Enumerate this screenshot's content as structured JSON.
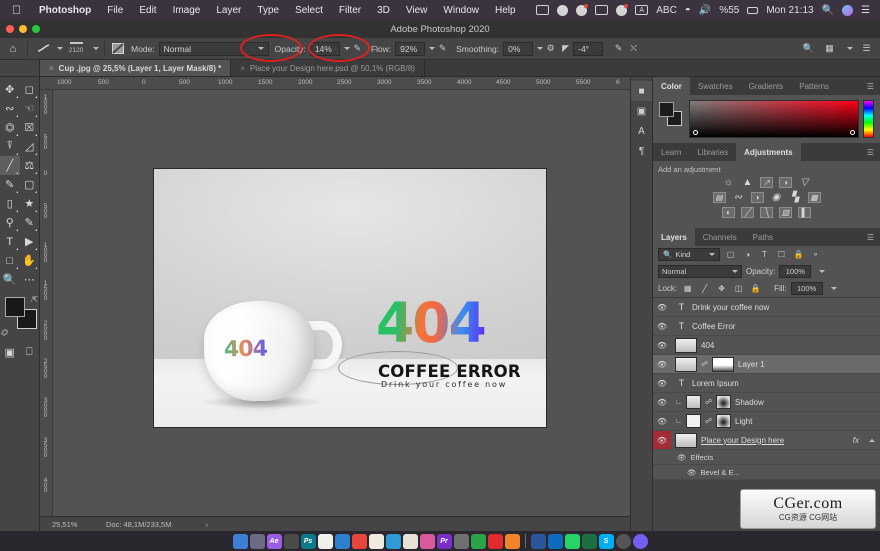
{
  "macbar": {
    "apple_icon": "apple-icon",
    "menus": [
      "Photoshop",
      "File",
      "Edit",
      "Image",
      "Layer",
      "Type",
      "Select",
      "Filter",
      "3D",
      "View",
      "Window",
      "Help"
    ],
    "status_icons": [
      "screen-record-icon",
      "checkmark-circle-icon",
      "phone-circle-icon",
      "display-icon",
      "globe-dot-icon",
      "keyboard-input-icon"
    ],
    "input_source": "ABC",
    "wifi_icon": "wifi-icon",
    "volume_icon": "volume-icon",
    "battery_text": "%55",
    "battery_icon": "battery-icon",
    "clock": "Mon 21:13",
    "search_icon": "search-icon",
    "siri_icon": "siri-icon",
    "control_center_icon": "control-center-icon"
  },
  "window": {
    "title": "Adobe Photoshop 2020",
    "traffic_lights": [
      "close-button",
      "minimize-button",
      "maximize-button"
    ]
  },
  "options_bar": {
    "home_icon": "home-icon",
    "brush_tool_icon": "brush-preset-icon",
    "brush_size": "2120",
    "brush_panel_icon": "brush-panel-icon",
    "mode_label": "Mode:",
    "mode_value": "Normal",
    "opacity_label": "Opacity:",
    "opacity_value": "14%",
    "pressure_opacity_icon": "pressure-opacity-icon",
    "flow_label": "Flow:",
    "flow_value": "92%",
    "airbrush_icon": "airbrush-icon",
    "smoothing_label": "Smoothing:",
    "smoothing_value": "0%",
    "smoothing_options_icon": "gear-icon",
    "angle_icon": "angle-icon",
    "angle_value": "-4°",
    "pressure_size_icon": "pressure-size-icon",
    "symmetry_icon": "symmetry-icon",
    "search_icon": "search-icon",
    "workspace_icon": "workspace-icon",
    "arrange_icon": "arrange-icon",
    "annotation_color": "#e02020"
  },
  "doc_tabs": [
    {
      "label": "Cup .jpg @ 25,5% (Layer 1, Layer Mask/8) *",
      "active": true,
      "close": "×"
    },
    {
      "label": "Place your Design here.psd @ 50,1% (RGB/8)",
      "active": false,
      "close": "×"
    }
  ],
  "toolbar": {
    "tools": [
      "move-tool",
      "marquee-tool",
      "lasso-tool",
      "quick-selection-tool",
      "crop-tool",
      "frame-tool",
      "eyedropper-tool",
      "healing-brush-tool",
      "brush-tool",
      "clone-stamp-tool",
      "history-brush-tool",
      "eraser-tool",
      "gradient-tool",
      "blur-tool",
      "dodge-tool",
      "pen-tool",
      "type-tool",
      "path-selection-tool",
      "rectangle-tool",
      "hand-tool",
      "zoom-tool",
      "more-tools"
    ],
    "selected_tool": "brush-tool",
    "foreground_color": "#181818",
    "background_color": "#1a1a1a",
    "swap_icon": "swap-colors-icon",
    "default_icon": "default-colors-icon",
    "quick_mask_icon": "quick-mask-icon",
    "screen_mode_icon": "screen-mode-icon"
  },
  "rulers": {
    "horizontal": [
      "1000",
      "500",
      "0",
      "500",
      "1000",
      "1500",
      "2000",
      "2500",
      "3000",
      "3500",
      "4000",
      "4500",
      "5000",
      "5500",
      "6"
    ],
    "vertical": [
      "1000",
      "500",
      "0",
      "500",
      "1000",
      "1500",
      "2000",
      "2500",
      "3000",
      "3500",
      "400"
    ]
  },
  "canvas": {
    "mug_logo_text": "404",
    "logo_number": "404",
    "logo_title": "COFFEE ERROR",
    "logo_subtitle": "Drink your coffee now"
  },
  "status_bar": {
    "zoom": "25,51%",
    "doc_info": "Doc: 48,1M/233,5M",
    "arrow": "›"
  },
  "right_rail": [
    "color-rail-icon",
    "history-rail-icon",
    "character-rail-icon",
    "paragraph-rail-icon"
  ],
  "color_panel": {
    "tabs": [
      {
        "label": "Color",
        "active": true
      },
      {
        "label": "Swatches",
        "active": false
      },
      {
        "label": "Gradients",
        "active": false
      },
      {
        "label": "Patterns",
        "active": false
      }
    ],
    "menu_icon": "panel-menu-icon",
    "foreground": "#1c1c1c",
    "background": "#1c1c1c",
    "ramp_hue": "#ff0018"
  },
  "adjustments_panel": {
    "tabs": [
      {
        "label": "Learn",
        "active": false
      },
      {
        "label": "Libraries",
        "active": false
      },
      {
        "label": "Adjustments",
        "active": true
      }
    ],
    "menu_icon": "panel-menu-icon",
    "heading": "Add an adjustment",
    "rows": [
      [
        "brightness-contrast-icon",
        "levels-icon",
        "curves-icon",
        "exposure-icon",
        "vibrance-icon"
      ],
      [
        "hue-saturation-icon",
        "color-balance-icon",
        "black-white-icon",
        "photo-filter-icon",
        "channel-mixer-icon",
        "color-lookup-icon"
      ],
      [
        "invert-icon",
        "posterize-icon",
        "threshold-icon",
        "gradient-map-icon",
        "selective-color-icon"
      ]
    ]
  },
  "layers_panel": {
    "tabs": [
      {
        "label": "Layers",
        "active": true
      },
      {
        "label": "Channels",
        "active": false
      },
      {
        "label": "Paths",
        "active": false
      }
    ],
    "menu_icon": "panel-menu-icon",
    "filter_icon": "search-icon",
    "filter_label": "Kind",
    "filter_toggles": [
      "pixel-filter-icon",
      "adjustment-filter-icon",
      "type-filter-icon",
      "shape-filter-icon",
      "smart-object-filter-icon"
    ],
    "filter_power_icon": "filter-power-icon",
    "blend_mode": "Normal",
    "opacity_label": "Opacity:",
    "opacity_value": "100%",
    "lock_label": "Lock:",
    "lock_icons": [
      "lock-transparent-icon",
      "lock-image-icon",
      "lock-position-icon",
      "lock-artboard-icon",
      "lock-all-icon"
    ],
    "fill_label": "Fill:",
    "fill_value": "100%",
    "layers": [
      {
        "name": "Drink your coffee now",
        "type": "text",
        "visible": true,
        "selected": false
      },
      {
        "name": "Coffee Error",
        "type": "text",
        "visible": true,
        "selected": false
      },
      {
        "name": "404",
        "type": "smart",
        "visible": true,
        "selected": false
      },
      {
        "name": "Layer 1",
        "type": "masked",
        "visible": true,
        "selected": true
      },
      {
        "name": "Lorem Ipsum",
        "type": "text",
        "visible": true,
        "selected": false
      },
      {
        "name": "Shadow",
        "type": "masked-clipped",
        "visible": true,
        "selected": false
      },
      {
        "name": "Light",
        "type": "masked-clipped",
        "visible": true,
        "selected": false
      },
      {
        "name": "Place your Design here",
        "type": "smart-fx",
        "visible": true,
        "selected": false,
        "highlight": "red",
        "fx": "fx"
      }
    ],
    "effects_label": "Effects",
    "effect_items": [
      "Bevel & E..."
    ],
    "effects_eye_icon": "eye-icon",
    "effect_eye_icon": "eye-icon"
  },
  "dock": {
    "apps": [
      {
        "name": "finder-dock-icon",
        "color": "#3d7fd6",
        "glyph": ""
      },
      {
        "name": "launchpad-dock-icon",
        "color": "#6b6b83",
        "glyph": ""
      },
      {
        "name": "after-effects-dock-icon",
        "color": "#9b5de5",
        "glyph": "Ae"
      },
      {
        "name": "safari-dock-icon",
        "color": "#4b4b4b",
        "glyph": ""
      },
      {
        "name": "photoshop-dock-icon",
        "color": "#0b7a8a",
        "glyph": "Ps"
      },
      {
        "name": "notes-dock-icon",
        "color": "#f2f0ea",
        "glyph": ""
      },
      {
        "name": "browser-dock-icon",
        "color": "#2f7fd0",
        "glyph": ""
      },
      {
        "name": "calendar-dock-icon",
        "color": "#e8453c",
        "glyph": ""
      },
      {
        "name": "books-dock-icon",
        "color": "#efe9e0",
        "glyph": ""
      },
      {
        "name": "edge-dock-icon",
        "color": "#2e9bd6",
        "glyph": ""
      },
      {
        "name": "notepad-dock-icon",
        "color": "#e6e2d8",
        "glyph": ""
      },
      {
        "name": "music-dock-icon",
        "color": "#d95a9a",
        "glyph": ""
      },
      {
        "name": "premiere-dock-icon",
        "color": "#7a2fc9",
        "glyph": "Pr"
      },
      {
        "name": "settings-dock-icon",
        "color": "#707070",
        "glyph": ""
      },
      {
        "name": "chrome-dock-icon",
        "color": "#2ca24a",
        "glyph": ""
      },
      {
        "name": "opera-dock-icon",
        "color": "#e22b2b",
        "glyph": ""
      },
      {
        "name": "mail-dock-icon",
        "color": "#f0862c",
        "glyph": ""
      }
    ],
    "apps2": [
      {
        "name": "word-dock-icon",
        "color": "#2b579a",
        "glyph": ""
      },
      {
        "name": "outlook-dock-icon",
        "color": "#0f6cbd",
        "glyph": ""
      },
      {
        "name": "whatsapp-dock-icon",
        "color": "#25d366",
        "glyph": ""
      },
      {
        "name": "excel-dock-icon",
        "color": "#1d6f42",
        "glyph": ""
      },
      {
        "name": "skype-dock-icon",
        "color": "#00aff0",
        "glyph": "S"
      },
      {
        "name": "trash-dock-icon",
        "color": "#555555",
        "glyph": ""
      },
      {
        "name": "viber-dock-icon",
        "color": "#7360f2",
        "glyph": ""
      }
    ]
  },
  "watermark": {
    "title": "CGer.com",
    "subtitle": "CG资源 CG网站"
  }
}
